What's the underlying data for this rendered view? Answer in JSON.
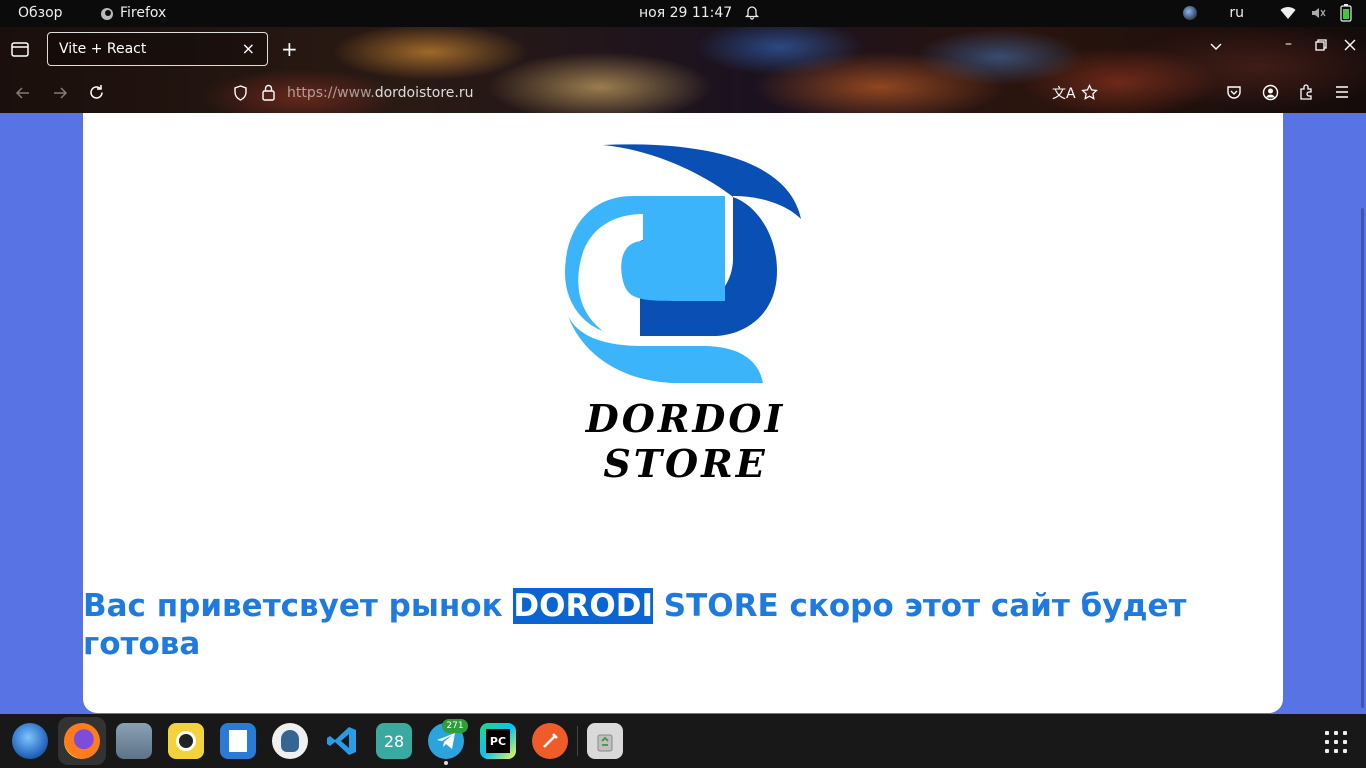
{
  "topbar": {
    "overview": "Обзор",
    "app_name": "Firefox",
    "clock": "ноя 29  11:47",
    "lang": "ru"
  },
  "browser": {
    "tab_title": "Vite + React",
    "url_protocol": "https://www.",
    "url_domain": "dordoistore.ru"
  },
  "page": {
    "logo_text": "DORDOI  STORE",
    "welcome_before": "Вас приветсвует рынок ",
    "welcome_highlight": "DORODI",
    "welcome_after": " STORE скоро этот сайт будет готова"
  },
  "dock": {
    "calendar_day": "28",
    "telegram_badge": "271",
    "pycharm_label": "PC"
  },
  "colors": {
    "page_bg": "#5874e4",
    "heading": "#1f7ae0",
    "logo_dark": "#0a4fb4",
    "logo_light": "#3bb4fb"
  }
}
